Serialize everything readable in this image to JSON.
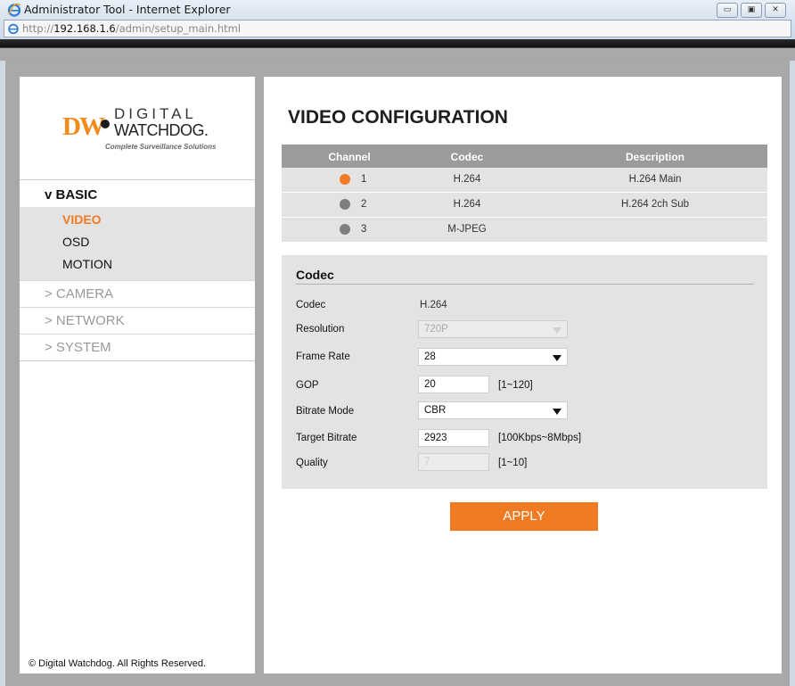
{
  "window": {
    "title": "Administrator Tool - Internet Explorer",
    "address_scheme": "http://",
    "address_host": "192.168.1.6",
    "address_path": "/admin/setup_main.html"
  },
  "logo": {
    "brand_mark": "DW",
    "line1": "DIGITAL",
    "line2": "WATCHDOG.",
    "tagline": "Complete Surveillance Solutions"
  },
  "sidebar": {
    "basic_label": "v BASIC",
    "basic_items": [
      "VIDEO",
      "OSD",
      "MOTION"
    ],
    "menu": [
      "> CAMERA",
      "> NETWORK",
      "> SYSTEM"
    ],
    "copyright": "© Digital Watchdog. All Rights Reserved."
  },
  "page": {
    "title": "VIDEO CONFIGURATION"
  },
  "channels": {
    "headers": [
      "Channel",
      "Codec",
      "Description"
    ],
    "rows": [
      {
        "num": "1",
        "codec": "H.264",
        "description": "H.264 Main",
        "selected": true
      },
      {
        "num": "2",
        "codec": "H.264",
        "description": "H.264 2ch Sub",
        "selected": false
      },
      {
        "num": "3",
        "codec": "M-JPEG",
        "description": "",
        "selected": false
      }
    ]
  },
  "codec_panel": {
    "title": "Codec",
    "codec_label": "Codec",
    "codec_value": "H.264",
    "resolution_label": "Resolution",
    "resolution_value": "720P",
    "frame_rate_label": "Frame Rate",
    "frame_rate_value": "28",
    "gop_label": "GOP",
    "gop_value": "20",
    "gop_range": "[1~120]",
    "bitrate_mode_label": "Bitrate Mode",
    "bitrate_mode_value": "CBR",
    "target_bitrate_label": "Target Bitrate",
    "target_bitrate_value": "2923",
    "target_bitrate_range": "[100Kbps~8Mbps]",
    "quality_label": "Quality",
    "quality_value": "7",
    "quality_range": "[1~10]"
  },
  "apply_label": "APPLY",
  "colors": {
    "accent": "#f07b22",
    "header_gray": "#9b9b9b",
    "row_gray": "#e3e3e3"
  }
}
